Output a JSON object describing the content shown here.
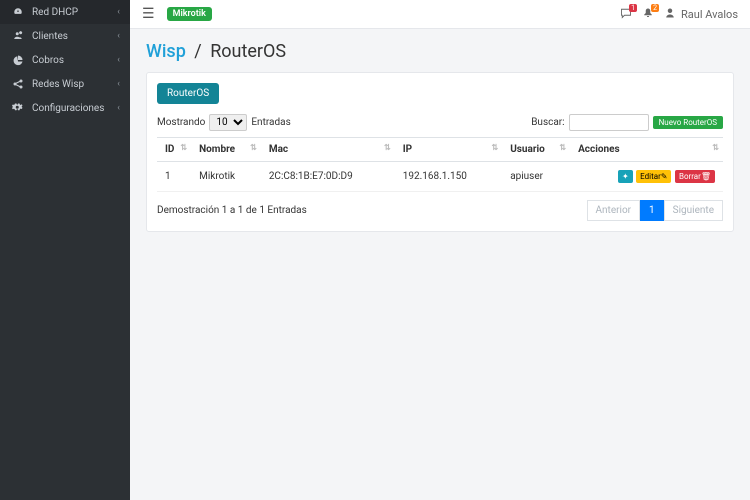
{
  "sidebar": {
    "items": [
      {
        "label": "Red DHCP",
        "icon": "dashboard"
      },
      {
        "label": "Clientes",
        "icon": "users"
      },
      {
        "label": "Cobros",
        "icon": "pie"
      },
      {
        "label": "Redes Wisp",
        "icon": "share"
      },
      {
        "label": "Configuraciones",
        "icon": "cogs"
      }
    ]
  },
  "topbar": {
    "badge": "Mikrotik",
    "notif1_count": "1",
    "notif2_count": "2",
    "user_name": "Raul Avalos"
  },
  "breadcrumb": {
    "root": "Wisp",
    "sep": "/",
    "current": "RouterOS"
  },
  "card": {
    "tab_label": "RouterOS",
    "length_prefix": "Mostrando",
    "length_value": "10",
    "length_suffix": "Entradas",
    "search_label": "Buscar:",
    "search_value": "",
    "new_btn": "Nuevo RouterOS",
    "columns": [
      "ID",
      "Nombre",
      "Mac",
      "IP",
      "Usuario",
      "Acciones"
    ],
    "rows": [
      {
        "id": "1",
        "nombre": "Mikrotik",
        "mac": "2C:C8:1B:E7:0D:D9",
        "ip": "192.168.1.150",
        "usuario": "apiuser"
      }
    ],
    "actions": {
      "info": "",
      "edit": "Editar",
      "delete": "Borrar"
    },
    "info_text": "Demostración 1 a 1 de 1 Entradas",
    "pager": {
      "prev": "Anterior",
      "page": "1",
      "next": "Siguiente"
    }
  }
}
